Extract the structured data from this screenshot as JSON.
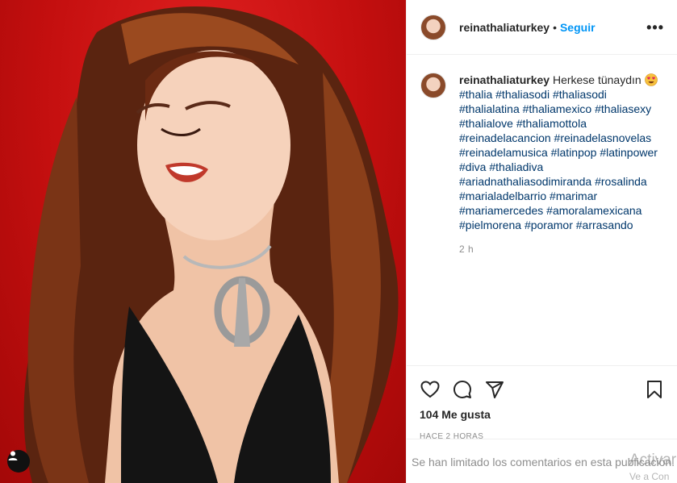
{
  "post": {
    "username": "reinathaliaturkey",
    "separator": "•",
    "follow_label": "Seguir",
    "more_label": "•••",
    "caption": {
      "username": "reinathaliaturkey",
      "text": "Herkese tünaydın",
      "hashtags": "#thalia #thaliasodi #thaliasodi #thalialatina #thaliamexico #thaliasexy #thalialove #thaliamottola #reinadelacancion #reinadelasnovelas #reinadelamusica #latinpop #latinpower #diva #thaliadiva #ariadnathaliasodimiranda #rosalinda #marialadelbarrio #marimar #mariamercedes #amoralamexicana #pielmorena #poramor #arrasando",
      "time": "2 h"
    },
    "likes": "104 Me gusta",
    "date": "HACE 2 HORAS",
    "comments_disabled": "Se han limitado los comentarios en esta publicación."
  },
  "overlay": {
    "activate_windows": "Activar",
    "activate_sub": "Ve a Con"
  },
  "icons": {
    "like": "heart-icon",
    "comment": "comment-icon",
    "share": "paper-plane-icon",
    "save": "bookmark-icon",
    "tag": "user-tag-icon",
    "emoji": "heart-eyes-emoji-icon"
  },
  "colors": {
    "accent": "#0095f6",
    "hashtag": "#00376b",
    "secondary_text": "#8e8e8e",
    "photo_background": "#c40f0f"
  }
}
